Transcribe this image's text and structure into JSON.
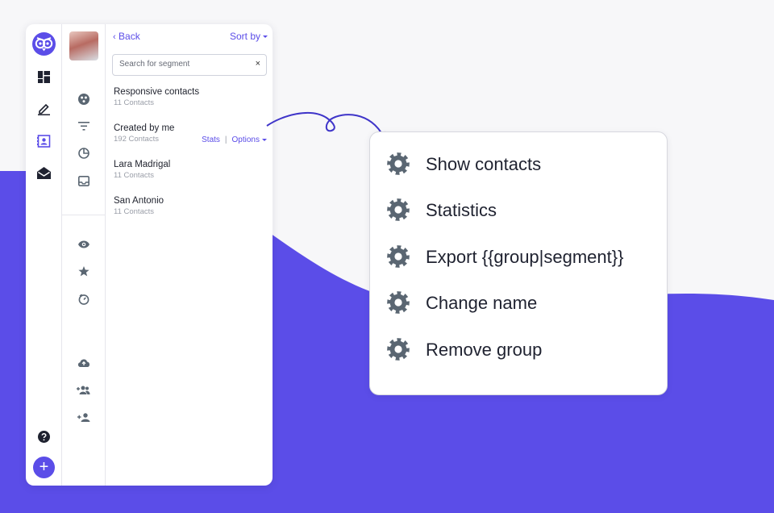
{
  "colors": {
    "accent": "#5b4de8",
    "text": "#222530",
    "muted": "#9a9ea8",
    "icon": "#5a6672"
  },
  "rail": {
    "icons": [
      "owl-logo-icon",
      "dashboard-icon",
      "edit-icon",
      "contacts-icon",
      "inbox-icon",
      "help-icon",
      "plus-icon"
    ],
    "fab_label": "+"
  },
  "subrail": {
    "icons": [
      "segments-icon",
      "filter-icon",
      "pie-chart-icon",
      "inbox-tray-icon",
      "eye-icon",
      "star-icon",
      "timer-icon",
      "cloud-upload-icon",
      "group-add-icon",
      "person-add-icon"
    ]
  },
  "header": {
    "back_label": "Back",
    "sort_label": "Sort by"
  },
  "search": {
    "placeholder": "Search for segment",
    "clear_label": "×"
  },
  "segments": [
    {
      "name": "Responsive contacts",
      "count": "11 Contacts"
    },
    {
      "name": "Created by me",
      "count": "192 Contacts",
      "stats_label": "Stats",
      "separator": "|",
      "options_label": "Options"
    },
    {
      "name": "Lara Madrigal",
      "count": "11 Contacts"
    },
    {
      "name": "San Antonio",
      "count": "11 Contacts"
    }
  ],
  "popup_menu": [
    {
      "label": "Show contacts",
      "icon": "gear-icon"
    },
    {
      "label": "Statistics",
      "icon": "gear-icon"
    },
    {
      "label": "Export {{group|segment}}",
      "icon": "gear-icon"
    },
    {
      "label": "Change name",
      "icon": "gear-icon"
    },
    {
      "label": "Remove group",
      "icon": "gear-icon"
    }
  ]
}
